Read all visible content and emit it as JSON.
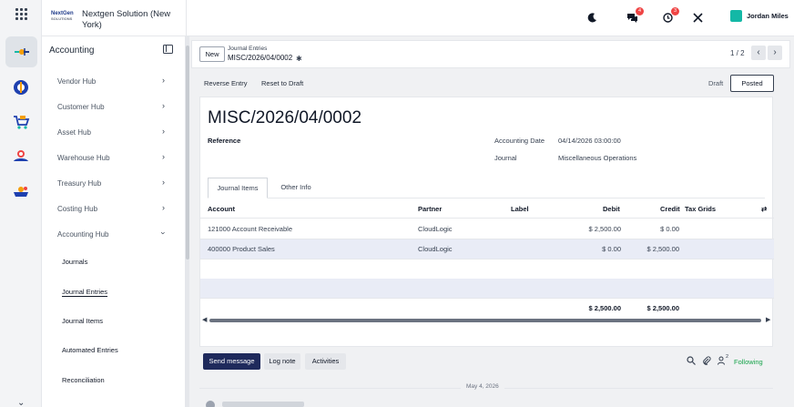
{
  "header": {
    "company_name": "Nextgen Solution (New York)",
    "company_logo_text": "NextGen SOLUTIONS",
    "discuss_badge": "4",
    "activity_badge": "3",
    "user_name": "Jordan Miles"
  },
  "sidebar": {
    "title": "Accounting",
    "items": [
      {
        "label": "Vendor Hub"
      },
      {
        "label": "Customer Hub"
      },
      {
        "label": "Asset Hub"
      },
      {
        "label": "Warehouse Hub"
      },
      {
        "label": "Treasury Hub"
      },
      {
        "label": "Costing Hub"
      },
      {
        "label": "Accounting Hub"
      }
    ],
    "subitems": [
      {
        "label": "Journals"
      },
      {
        "label": "Journal Entries"
      },
      {
        "label": "Journal Items"
      },
      {
        "label": "Automated Entries"
      },
      {
        "label": "Reconciliation"
      }
    ]
  },
  "breadcrumb": {
    "new_label": "New",
    "parent": "Journal Entries",
    "current": "MISC/2026/04/0002",
    "pager": "1 / 2"
  },
  "toolbar": {
    "reverse_entry": "Reverse Entry",
    "reset_to_draft": "Reset to Draft"
  },
  "status": {
    "draft": "Draft",
    "posted": "Posted"
  },
  "form": {
    "title": "MISC/2026/04/0002",
    "reference_label": "Reference",
    "accounting_date_label": "Accounting Date",
    "accounting_date_value": "04/14/2026 03:00:00",
    "journal_label": "Journal",
    "journal_value": "Miscellaneous Operations"
  },
  "tabs": [
    {
      "label": "Journal Items"
    },
    {
      "label": "Other Info"
    }
  ],
  "table": {
    "headers": {
      "account": "Account",
      "partner": "Partner",
      "label": "Label",
      "debit": "Debit",
      "credit": "Credit",
      "tax_grids": "Tax Grids"
    },
    "rows": [
      {
        "account": "121000 Account Receivable",
        "partner": "CloudLogic",
        "label": "",
        "debit": "$ 2,500.00",
        "credit": "$ 0.00"
      },
      {
        "account": "400000 Product Sales",
        "partner": "CloudLogic",
        "label": "",
        "debit": "$ 0.00",
        "credit": "$ 2,500.00"
      }
    ],
    "total_debit": "$ 2,500.00",
    "total_credit": "$ 2,500.00"
  },
  "chatter": {
    "send_message": "Send message",
    "log_note": "Log note",
    "activities": "Activities",
    "followers_count": "2",
    "following": "Following",
    "date_separator": "May 4, 2026"
  },
  "colors": {
    "accent": "#1f2a5c",
    "selected_row": "#e9ecf6",
    "following_green": "#16a34a",
    "badge_red": "#ef4444"
  }
}
